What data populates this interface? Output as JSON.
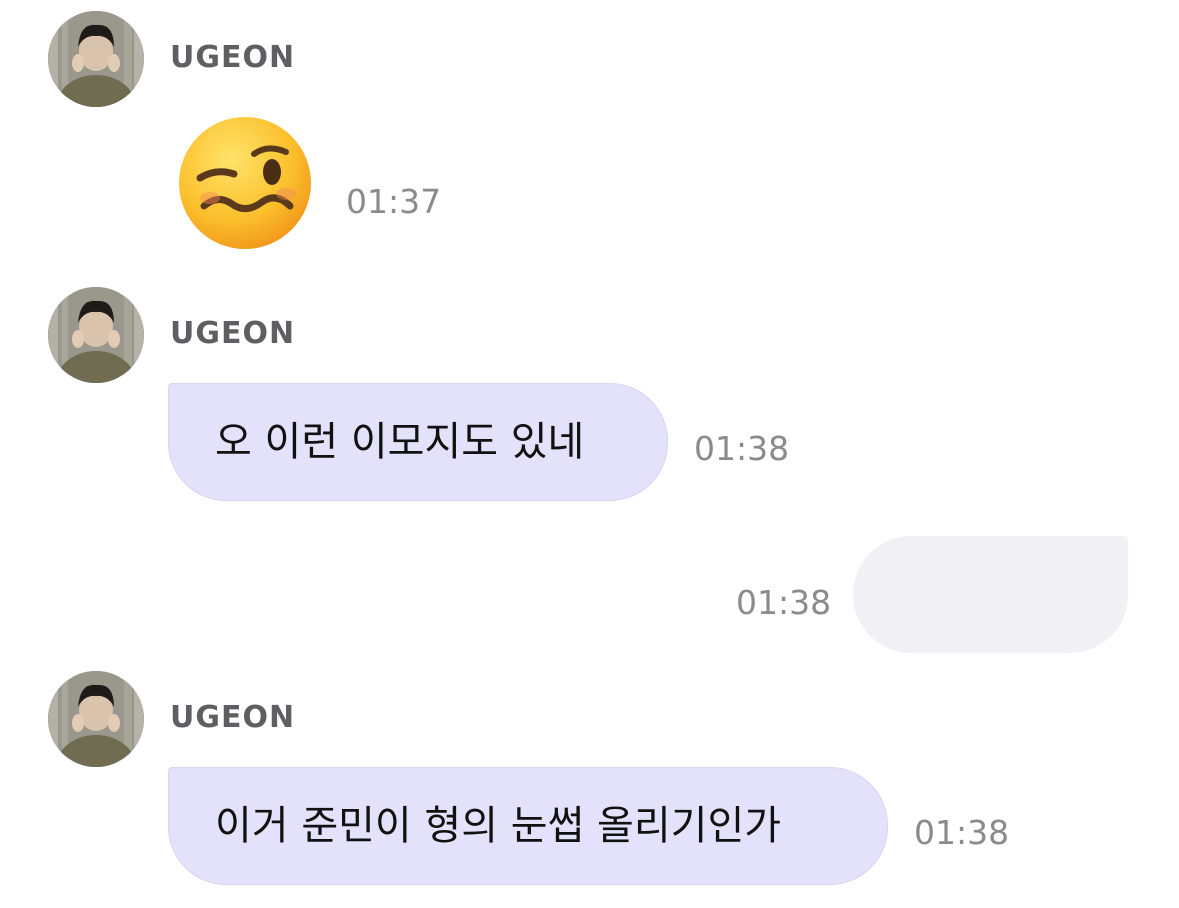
{
  "chat": {
    "messages": [
      {
        "sender": "UGEON",
        "avatar_icon": "user-avatar-photo",
        "content_type": "emoji",
        "emoji_icon": "face-with-uneven-eyes-and-wavy-mouth-emoji",
        "time": "01:37"
      },
      {
        "sender": "UGEON",
        "avatar_icon": "user-avatar-photo",
        "content_type": "text",
        "text": "오 이런 이모지도 있네",
        "time": "01:38"
      },
      {
        "sender": "me",
        "content_type": "text",
        "text": "",
        "time": "01:38"
      },
      {
        "sender": "UGEON",
        "avatar_icon": "user-avatar-photo",
        "content_type": "text",
        "text": "이거 준민이 형의 눈썹 올리기인가",
        "time": "01:38"
      }
    ]
  },
  "colors": {
    "incoming_bubble": "#e4e2fa",
    "outgoing_bubble": "#f1f1f5",
    "sender_name": "#5f5f63",
    "timestamp": "#8a8a8f"
  }
}
